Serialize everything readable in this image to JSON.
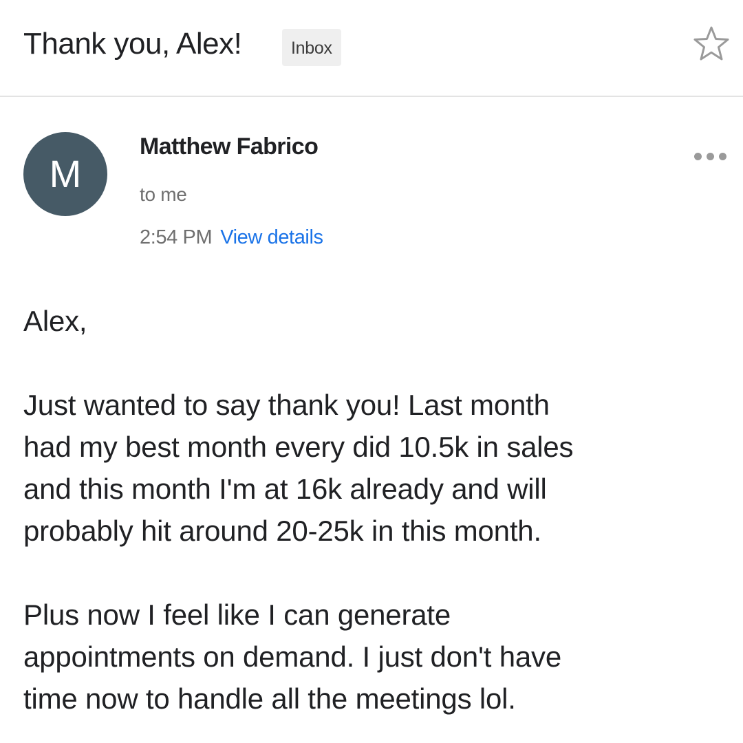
{
  "subject": {
    "title": "Thank you, Alex!",
    "label": "Inbox",
    "star_icon": "star-outline-icon"
  },
  "message": {
    "avatar_letter": "M",
    "avatar_color": "#465a66",
    "sender": "Matthew Fabrico",
    "recipient": "to me",
    "time": "2:54 PM",
    "details_link": "View details",
    "more_icon": "more-horizontal-icon",
    "link_color": "#1a73e8"
  },
  "body": {
    "greeting": "Alex,",
    "paragraph_1": [
      "Just wanted to say thank you! Last month",
      "had my best month every did 10.5k in sales",
      "and this month I'm at 16k already and will",
      "probably hit around 20-25k in this month."
    ],
    "paragraph_2": [
      "Plus now I feel like I can generate",
      "appointments on demand. I just don't have",
      "time now to handle all the meetings lol."
    ]
  }
}
